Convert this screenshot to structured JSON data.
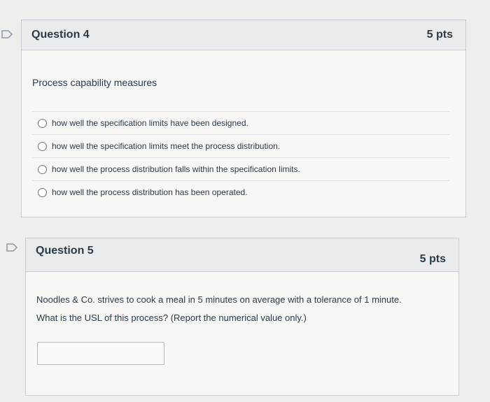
{
  "q4": {
    "title": "Question 4",
    "points": "5 pts",
    "prompt": "Process capability measures",
    "answers": [
      "how well the specification limits have been designed.",
      "how well the specification limits meet the process distribution.",
      "how well the process distribution falls within the specification limits.",
      "how well the process distribution has been operated."
    ]
  },
  "q5": {
    "title": "Question 5",
    "points": "5 pts",
    "prompt_line1": "Noodles & Co. strives to cook a meal in 5 minutes on average with a tolerance of 1 minute.",
    "prompt_line2": "What is the USL of this process? (Report the numerical value only.)",
    "answer_value": ""
  },
  "colors": {
    "flag": "#8a98a4",
    "header_bg": "#e9ebec",
    "body_bg": "#f7f7f6",
    "border": "#c7cdd1"
  }
}
